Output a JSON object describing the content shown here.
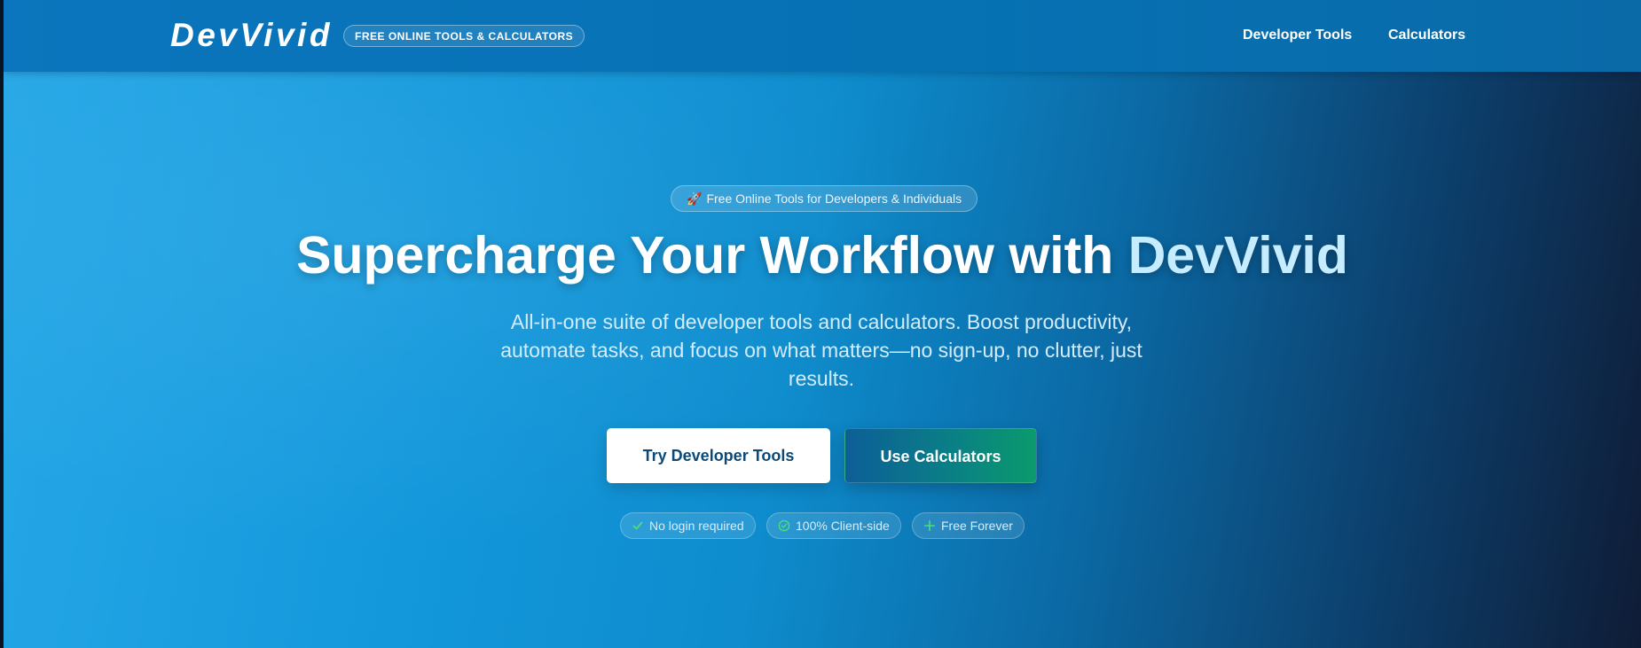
{
  "header": {
    "logo_text": "DevVivid",
    "badge_text": "FREE ONLINE TOOLS & CALCULATORS",
    "nav": [
      {
        "label": "Developer Tools"
      },
      {
        "label": "Calculators"
      }
    ]
  },
  "hero": {
    "top_pill": {
      "icon": "rocket-icon",
      "icon_glyph": "🚀",
      "text": "Free Online Tools for Developers & Individuals"
    },
    "headline_main": "Supercharge Your Workflow with ",
    "headline_accent": "DevVivid",
    "subtitle": "All-in-one suite of developer tools and calculators. Boost productivity, automate tasks, and focus on what matters—no sign-up, no clutter, just results.",
    "buttons": {
      "primary_label": "Try Developer Tools",
      "secondary_label": "Use Calculators"
    },
    "features": [
      {
        "icon": "checkmark-icon",
        "label": "No login required"
      },
      {
        "icon": "check-circle-icon",
        "label": "100% Client-side"
      },
      {
        "icon": "plus-icon",
        "label": "Free Forever"
      }
    ]
  },
  "colors": {
    "header_bg": "#0672b4",
    "headline_accent": "#c6ecff",
    "primary_button_bg": "#ffffff",
    "primary_button_text": "#0b4a78",
    "secondary_button_gradient_start": "#0d5e97",
    "secondary_button_gradient_end": "#0b9a6c",
    "feature_icon": "#4ade80"
  }
}
